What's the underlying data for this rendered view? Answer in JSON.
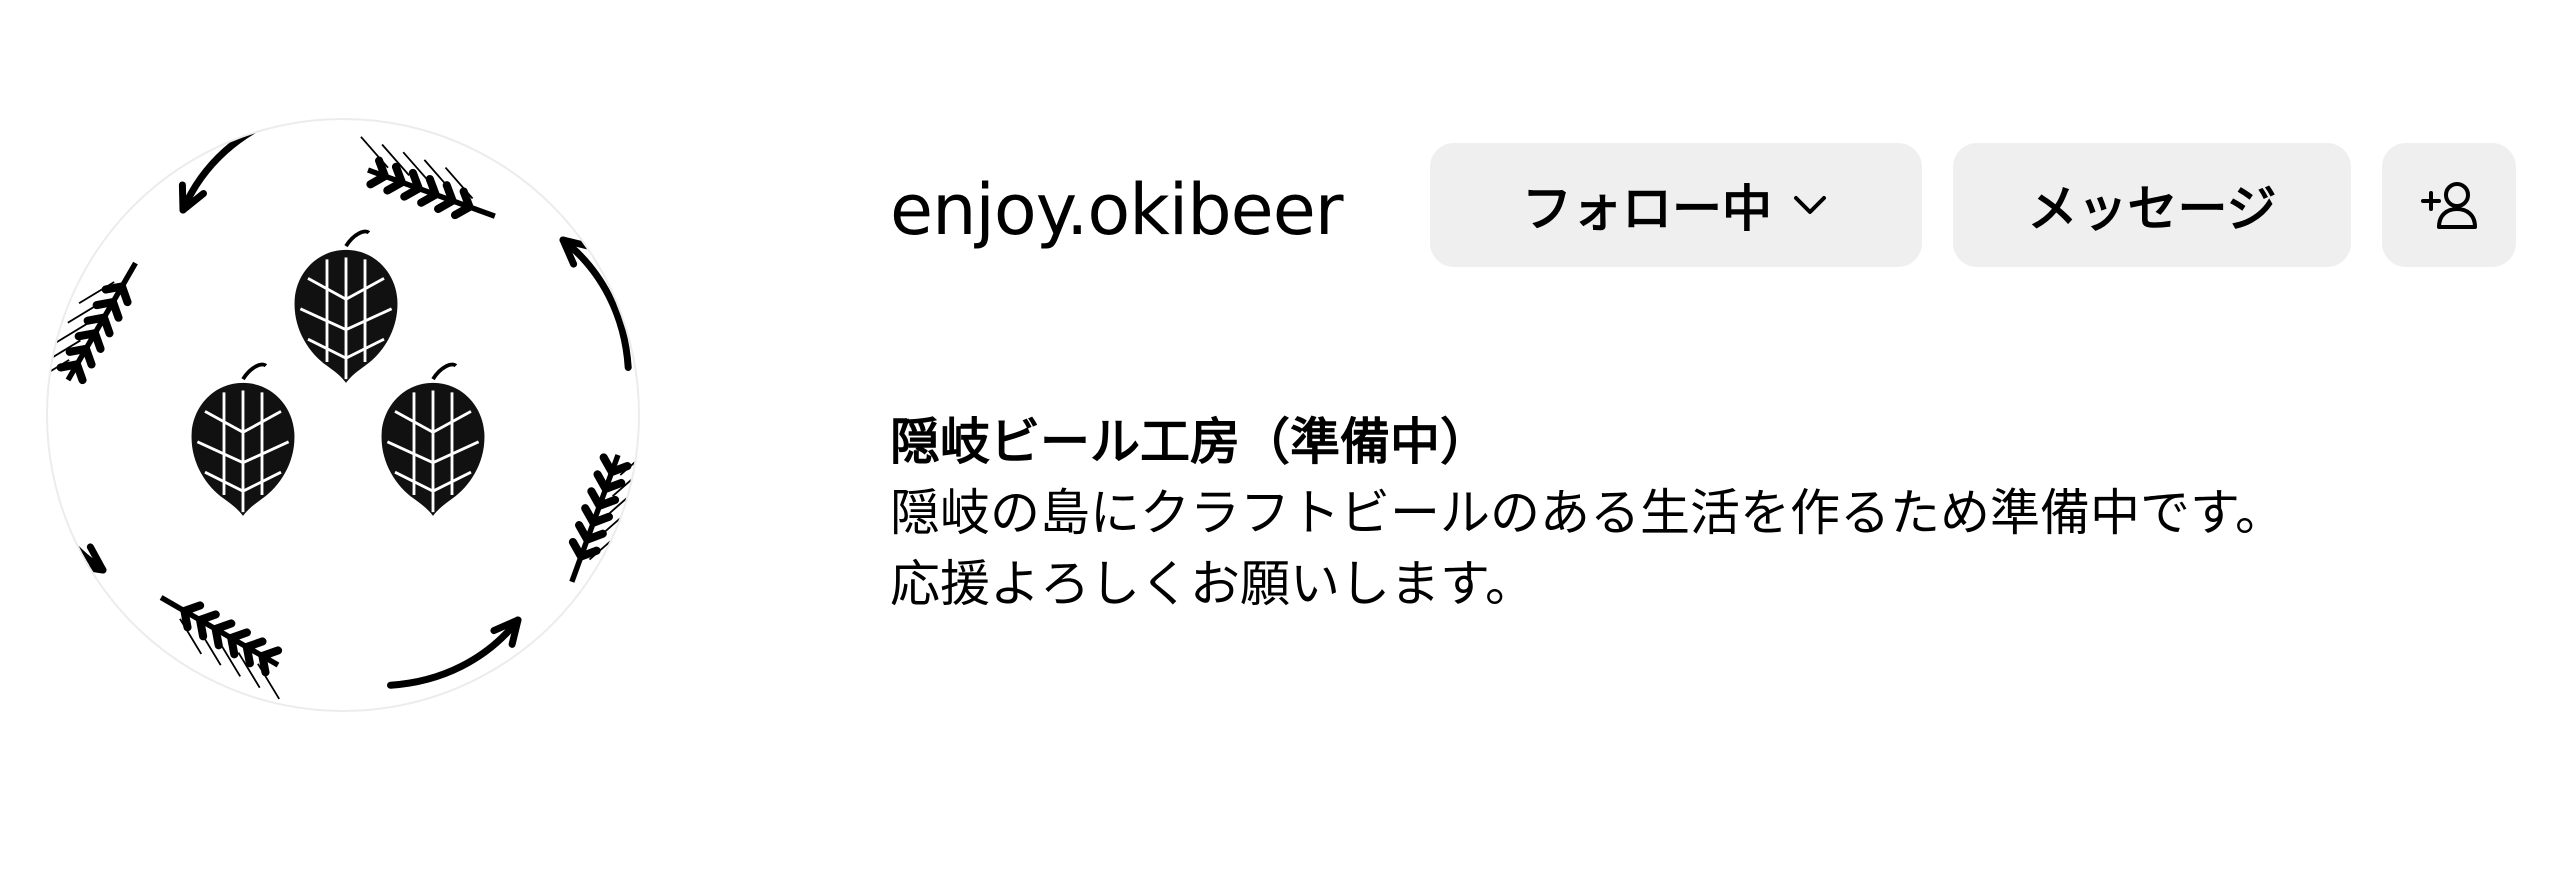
{
  "profile": {
    "username": "enjoy.okibeer",
    "avatar_icon": "hops-and-barley-logo",
    "buttons": {
      "following_label": "フォロー中",
      "following_icon": "chevron-down-icon",
      "message_label": "メッセージ",
      "add_user_icon": "add-user-icon"
    },
    "bio": {
      "name": "隠岐ビール工房（準備中）",
      "lines": [
        "隠岐の島にクラフトビールのある生活を作るため準備中です。",
        "応援よろしくお願いします。"
      ]
    }
  }
}
